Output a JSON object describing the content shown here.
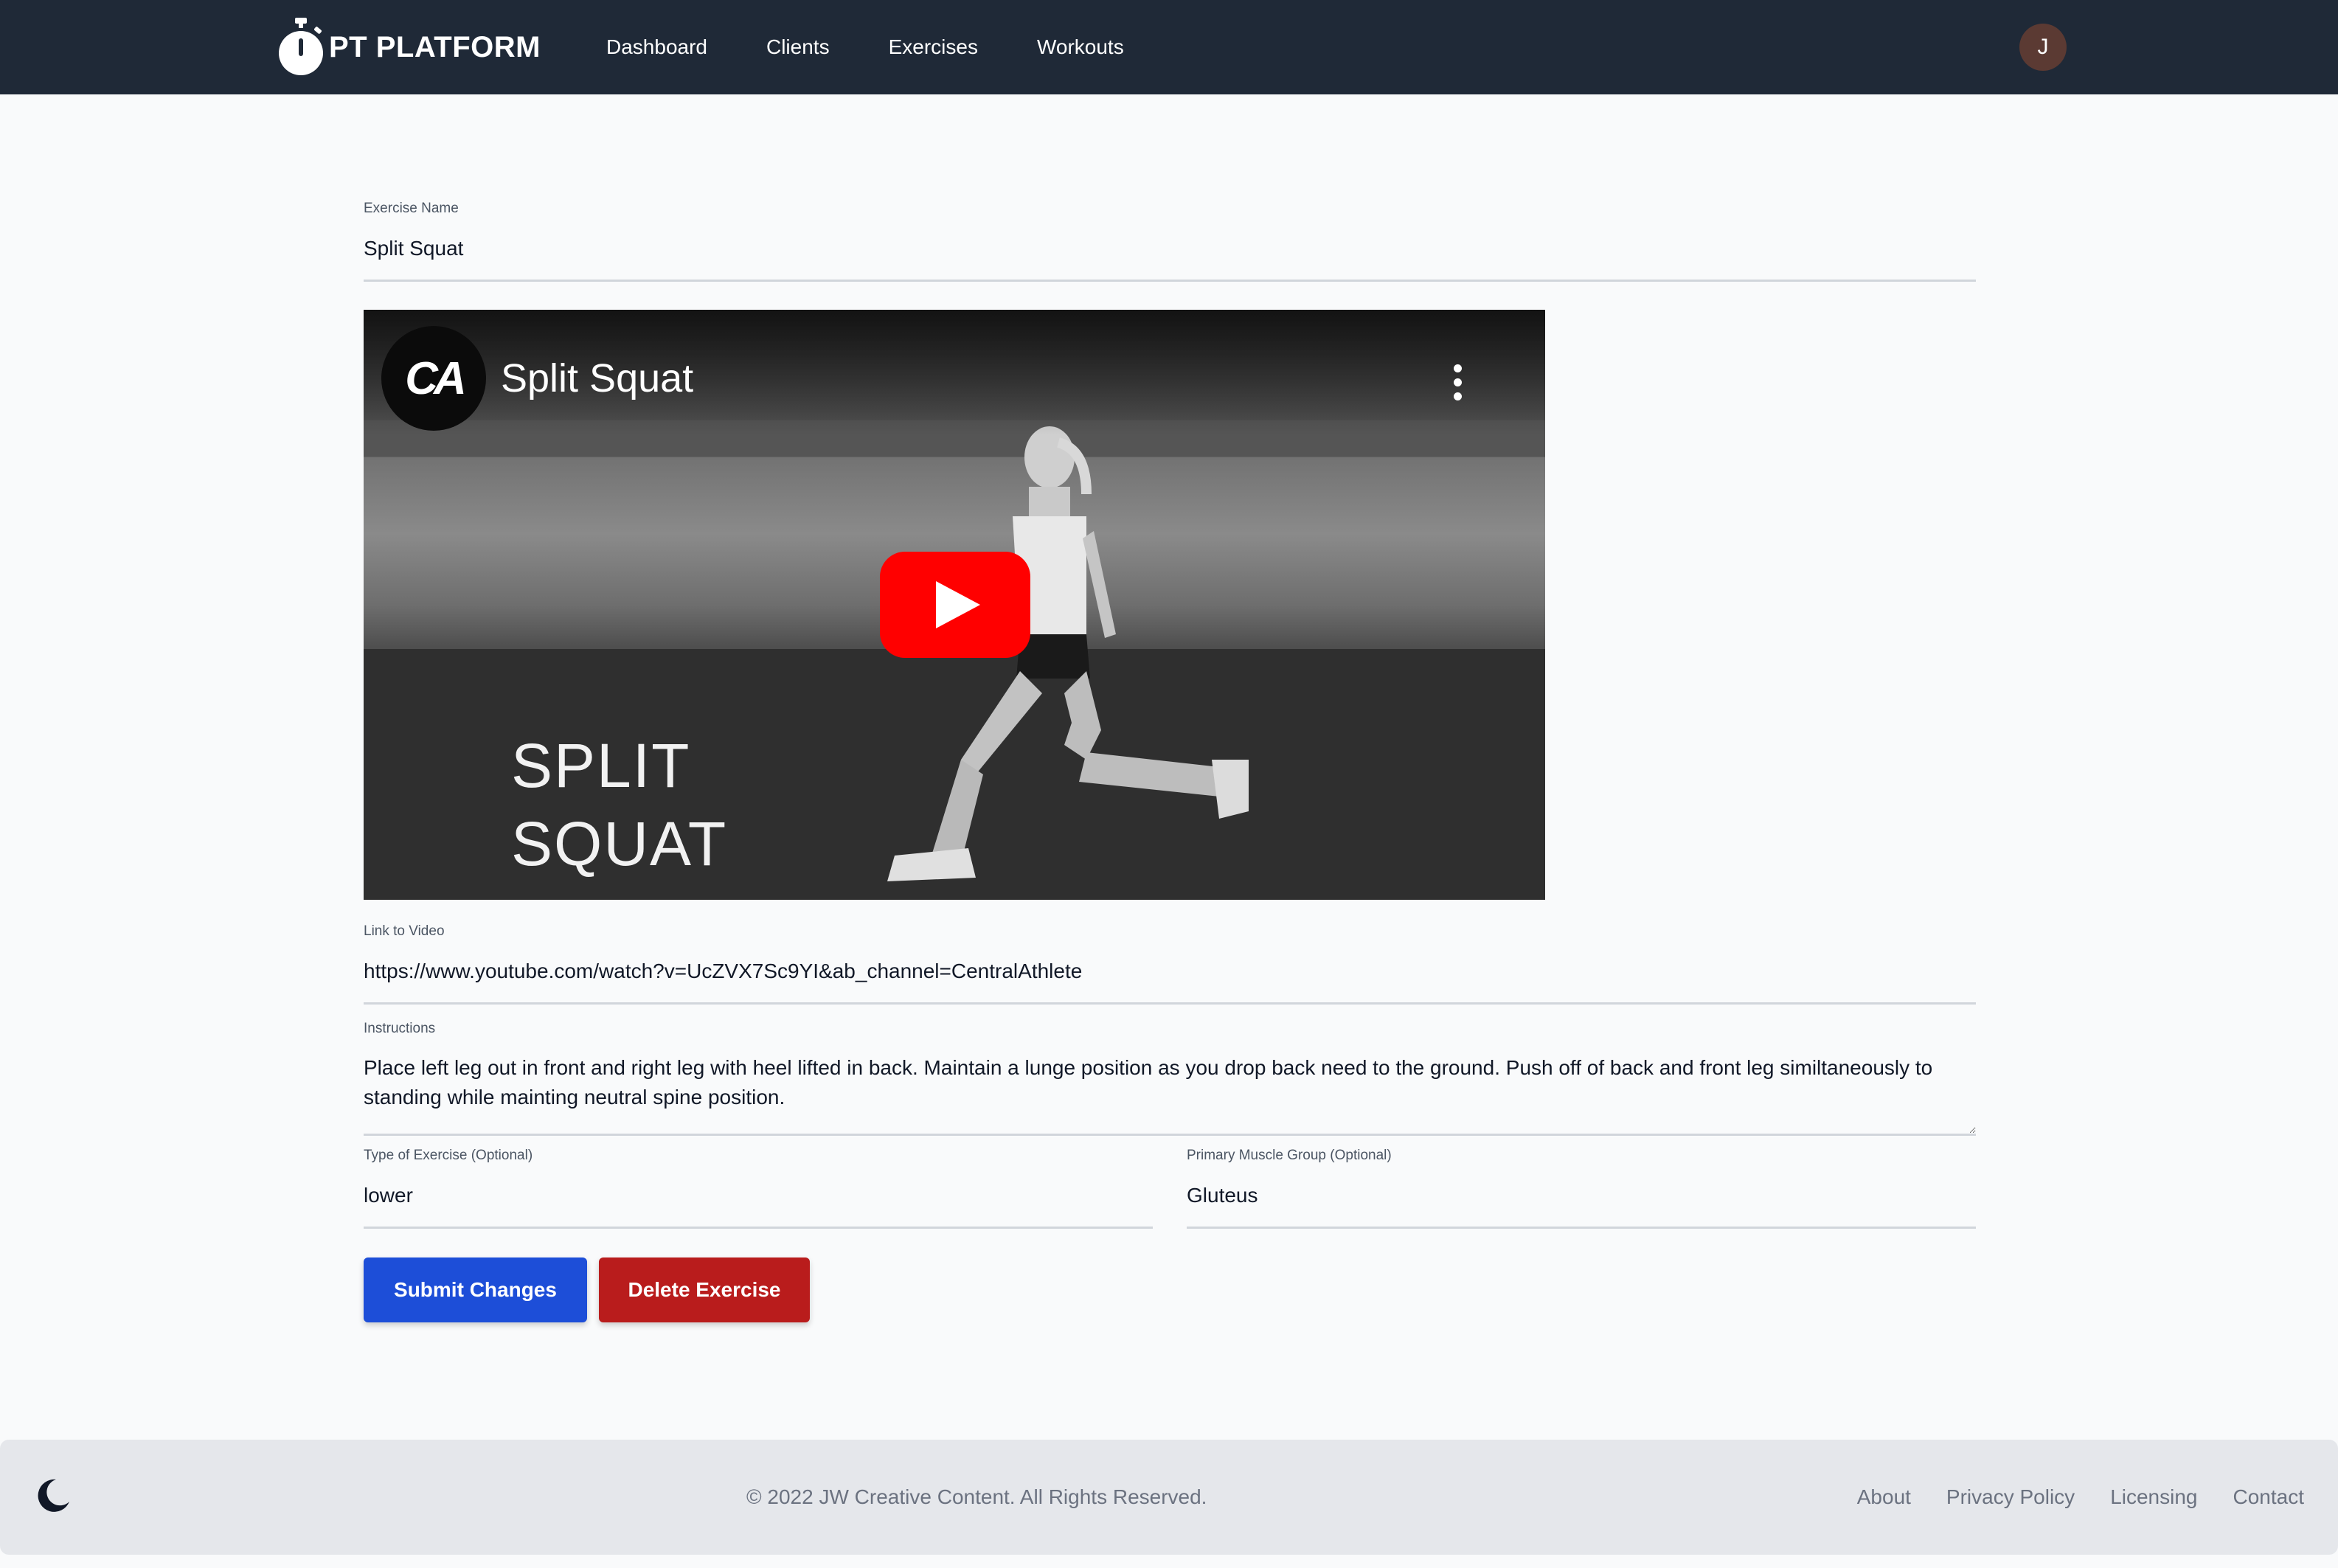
{
  "navbar": {
    "brand": "PT PLATFORM",
    "links": [
      "Dashboard",
      "Clients",
      "Exercises",
      "Workouts"
    ],
    "avatar_initial": "J"
  },
  "form": {
    "name_label": "Exercise Name",
    "name_value": "Split Squat",
    "link_label": "Link to Video",
    "link_value": "https://www.youtube.com/watch?v=UcZVX7Sc9YI&ab_channel=CentralAthlete",
    "instructions_label": "Instructions",
    "instructions_value": "Place left leg out in front and right leg with heel lifted in back. Maintain a lunge position as you drop back need to the ground. Push off of back and front leg similtaneously to standing while mainting neutral spine position.",
    "type_label": "Type of Exercise (Optional)",
    "type_value": "lower",
    "muscle_label": "Primary Muscle Group (Optional)",
    "muscle_value": "Gluteus"
  },
  "video": {
    "channel_logo_text": "CA",
    "title": "Split Squat",
    "overlay_line1": "SPLIT",
    "overlay_line2": "SQUAT"
  },
  "buttons": {
    "submit": "Submit Changes",
    "delete": "Delete Exercise"
  },
  "footer": {
    "copyright": "© 2022 JW Creative Content. All Rights Reserved.",
    "links": [
      "About",
      "Privacy Policy",
      "Licensing",
      "Contact"
    ]
  },
  "colors": {
    "navbar_bg": "#1f2937",
    "submit_button": "#1d4ed8",
    "delete_button": "#b91c1c",
    "youtube_red": "#ff0000",
    "avatar_bg": "#5b3a33"
  },
  "icons": {
    "brand": "stopwatch-icon",
    "theme_toggle": "moon-icon",
    "video_play": "play-icon",
    "video_menu": "kebab-menu-icon"
  }
}
